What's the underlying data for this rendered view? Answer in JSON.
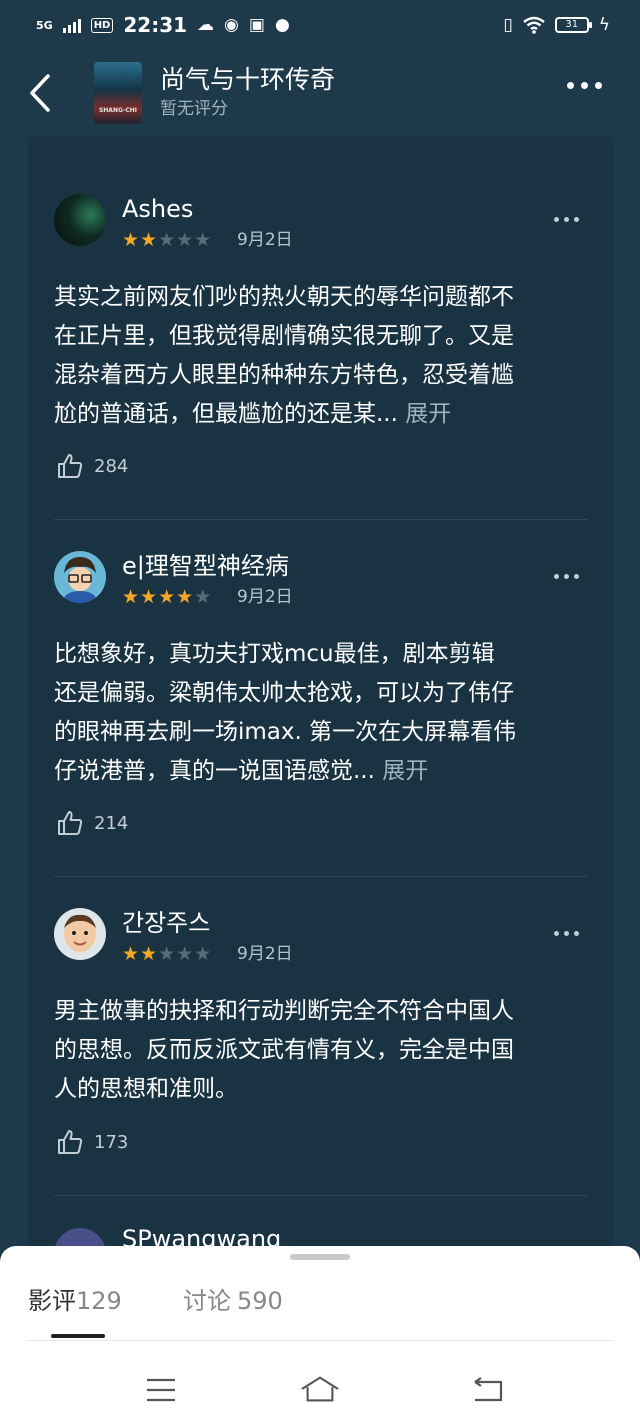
{
  "status_bar": {
    "network": "5G",
    "hd": "HD",
    "time": "22:31",
    "battery": "31",
    "icons": [
      "cloud-icon",
      "weibo-icon",
      "app-icon",
      "chat-icon",
      "vibrate-icon",
      "wifi-icon",
      "charging-icon"
    ]
  },
  "header": {
    "title": "尚气与十环传奇",
    "subtitle": "暂无评分",
    "poster_text": "SHANG-CHI"
  },
  "reviews": [
    {
      "user": "Ashes",
      "rating": 2,
      "max_rating": 5,
      "date": "9月2日",
      "lines": [
        "其实之前网友们吵的热火朝天的辱华问题都不",
        "在正片里，但我觉得剧情确实很无聊了。又是",
        "混杂着西方人眼里的种种东方特色，忍受着尴",
        "尬的普通话，但最尴尬的还是某..."
      ],
      "expand": "展开",
      "likes": "284"
    },
    {
      "user": "e|理智型神经病",
      "rating": 4,
      "max_rating": 5,
      "date": "9月2日",
      "lines": [
        "比想象好，真功夫打戏mcu最佳，剧本剪辑",
        "还是偏弱。梁朝伟太帅太抢戏，可以为了伟仔",
        "的眼神再去刷一场imax. 第一次在大屏幕看伟",
        "仔说港普，真的一说国语感觉..."
      ],
      "expand": "展开",
      "likes": "214"
    },
    {
      "user": "간장주스",
      "rating": 2,
      "max_rating": 5,
      "date": "9月2日",
      "lines": [
        "男主做事的抉择和行动判断完全不符合中国人",
        "的思想。反而反派文武有情有义，完全是中国",
        "人的思想和准则。"
      ],
      "expand": "",
      "likes": "173"
    },
    {
      "user": "SPwangwang"
    }
  ],
  "bottom_sheet": {
    "tab1_label": "影评",
    "tab1_count": "129",
    "tab2_label": "讨论",
    "tab2_count": "590"
  },
  "colors": {
    "background": "#1e3a4a",
    "card": "#1a3342",
    "star_on": "#f5a623",
    "star_off": "#5a6b75",
    "muted_text": "#9fb3bd"
  }
}
